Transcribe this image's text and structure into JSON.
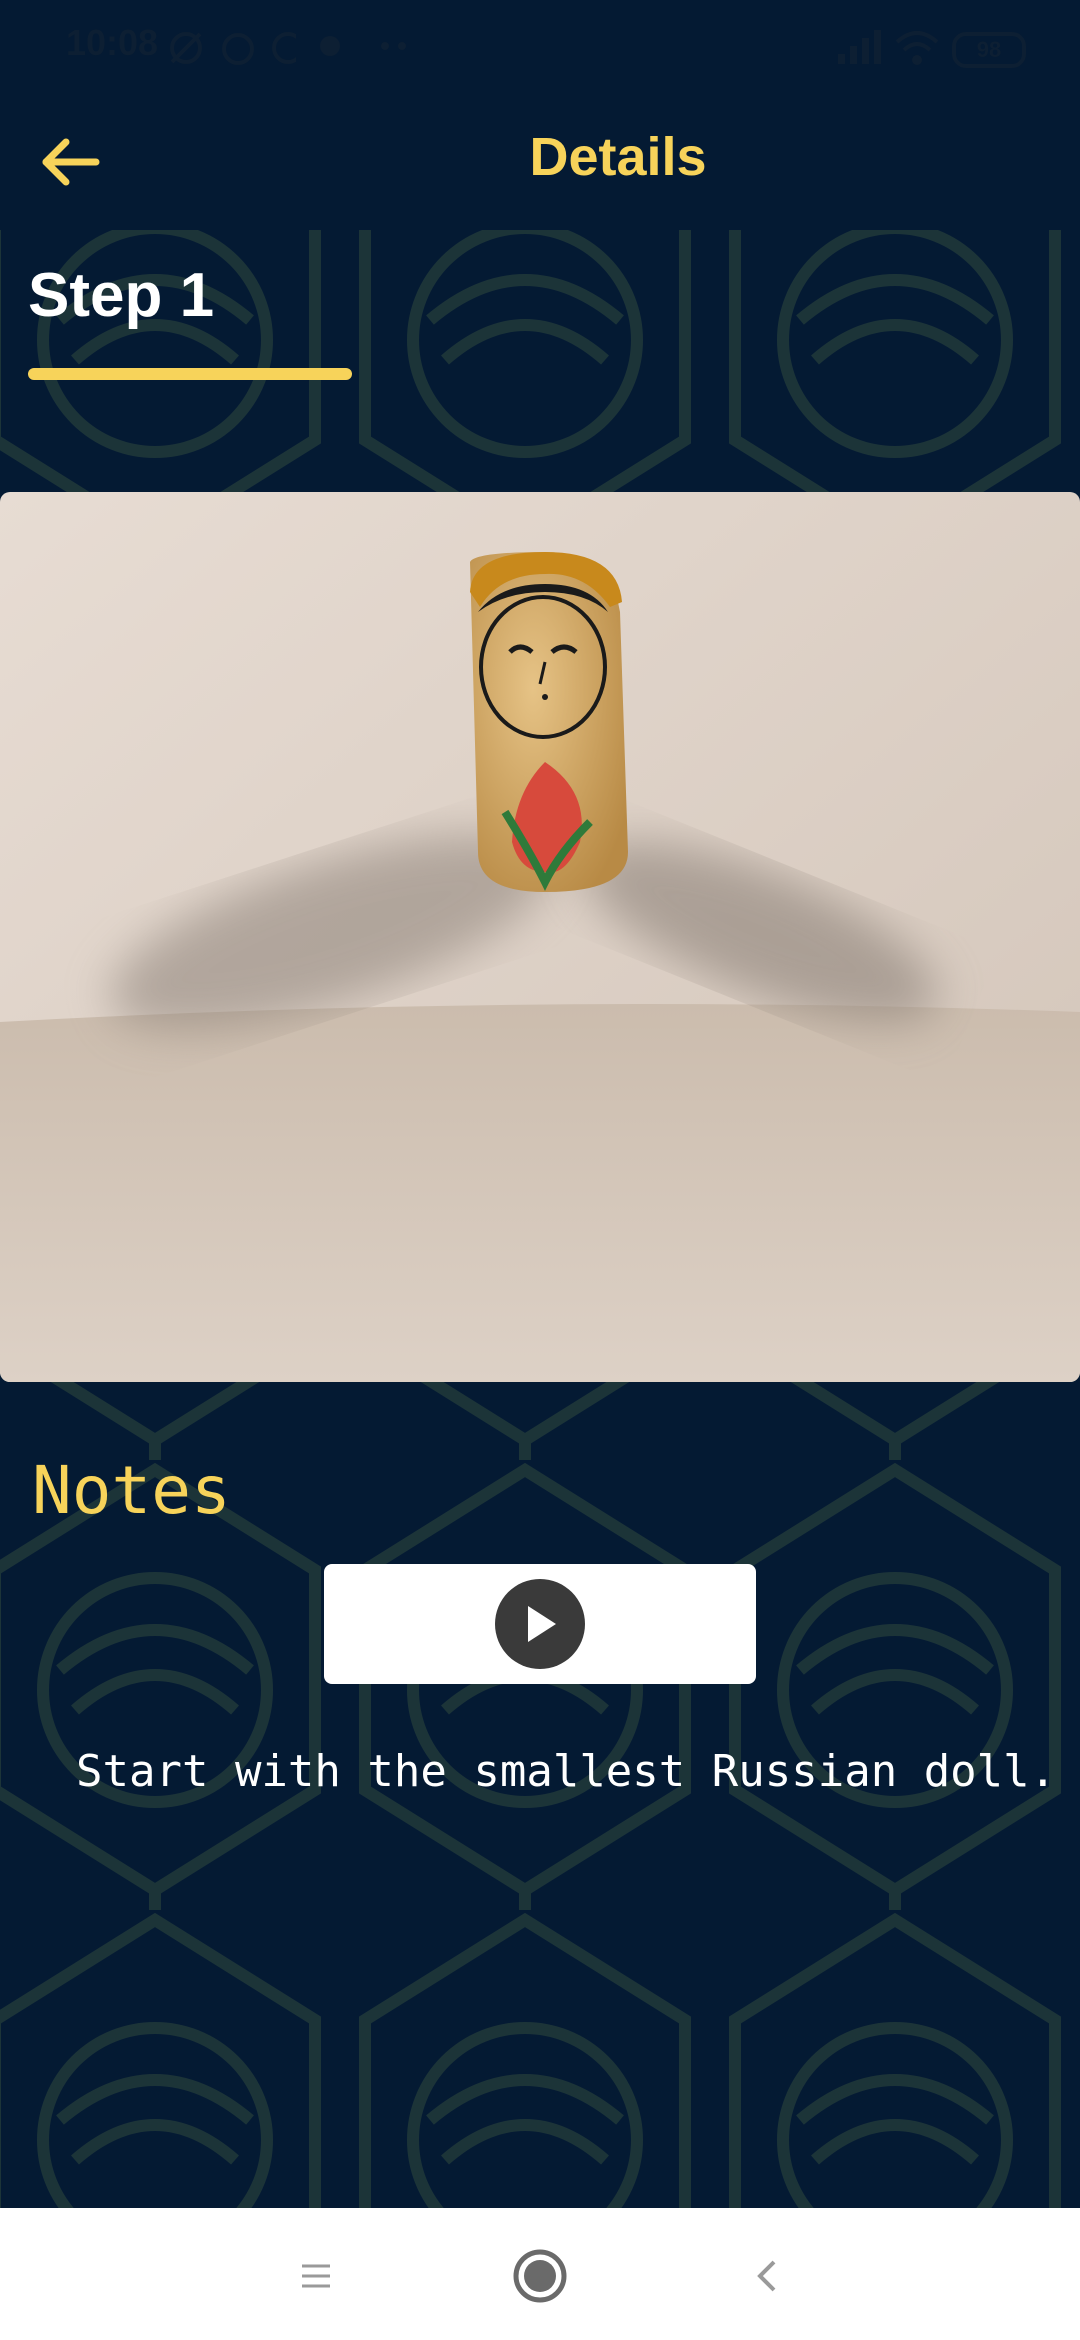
{
  "status_bar": {
    "time": "10:08",
    "battery": "98"
  },
  "app_bar": {
    "title": "Details",
    "back_icon": "arrow-left-icon"
  },
  "step": {
    "title": "Step 1"
  },
  "image": {
    "subject": "russian-doll-photo"
  },
  "notes": {
    "heading": "Notes",
    "text": "Start with the smallest Russian doll."
  },
  "colors": {
    "background": "#041a33",
    "accent": "#f7d35a",
    "text": "#ffffff"
  },
  "nav_bar": {
    "icons": [
      "menu-icon",
      "home-icon",
      "back-icon"
    ]
  }
}
